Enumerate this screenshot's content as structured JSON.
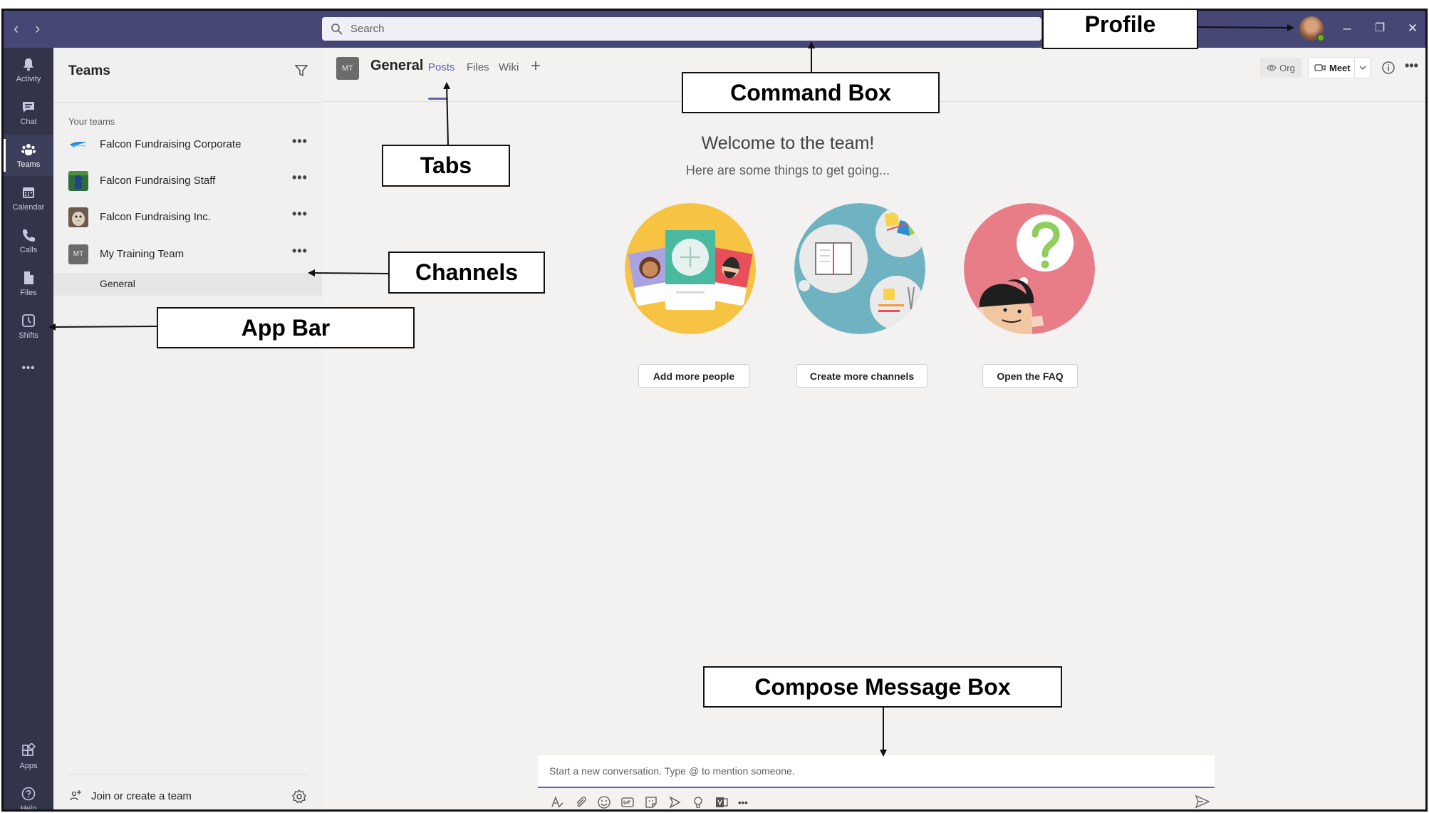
{
  "titlebar": {
    "nav_back": "‹",
    "nav_forward": "›",
    "search_placeholder": "Search",
    "window_controls": [
      "–",
      "❐",
      "✕"
    ]
  },
  "app_bar": [
    {
      "label": "Activity",
      "icon": "bell-icon"
    },
    {
      "label": "Chat",
      "icon": "chat-icon"
    },
    {
      "label": "Teams",
      "icon": "teams-icon",
      "active": true
    },
    {
      "label": "Calendar",
      "icon": "calendar-icon"
    },
    {
      "label": "Calls",
      "icon": "phone-icon"
    },
    {
      "label": "Files",
      "icon": "file-icon"
    },
    {
      "label": "Shifts",
      "icon": "clock-icon"
    },
    {
      "label": "Apps",
      "icon": "apps-icon"
    },
    {
      "label": "Help",
      "icon": "help-icon"
    }
  ],
  "app_bar_more": "•••",
  "teams_pane": {
    "title": "Teams",
    "section_label": "Your teams",
    "teams": [
      {
        "name": "Falcon Fundraising Corporate"
      },
      {
        "name": "Falcon Fundraising Staff"
      },
      {
        "name": "Falcon Fundraising Inc."
      },
      {
        "name": "My Training Team",
        "initials": "MT"
      }
    ],
    "more": "•••",
    "channel": "General",
    "join_label": "Join or create a team"
  },
  "main": {
    "team_initials": "MT",
    "channel_title": "General",
    "tabs": [
      "Posts",
      "Files",
      "Wiki"
    ],
    "tab_add": "+",
    "org_label": "Org",
    "meet_label": "Meet",
    "more": "•••",
    "welcome_title": "Welcome to the team!",
    "welcome_sub": "Here are some things to get going...",
    "actions": [
      "Add more people",
      "Create more channels",
      "Open the FAQ"
    ],
    "compose_placeholder": "Start a new conversation. Type @ to mention someone.",
    "compose_more": "•••"
  },
  "annotations": {
    "profile": "Profile",
    "command_box": "Command Box",
    "tabs": "Tabs",
    "channels": "Channels",
    "app_bar": "App Bar",
    "compose": "Compose Message Box"
  },
  "colors": {
    "titlebar": "#464775",
    "app_bar": "#33344a",
    "accent": "#6264a7",
    "presence": "#6bb700"
  }
}
